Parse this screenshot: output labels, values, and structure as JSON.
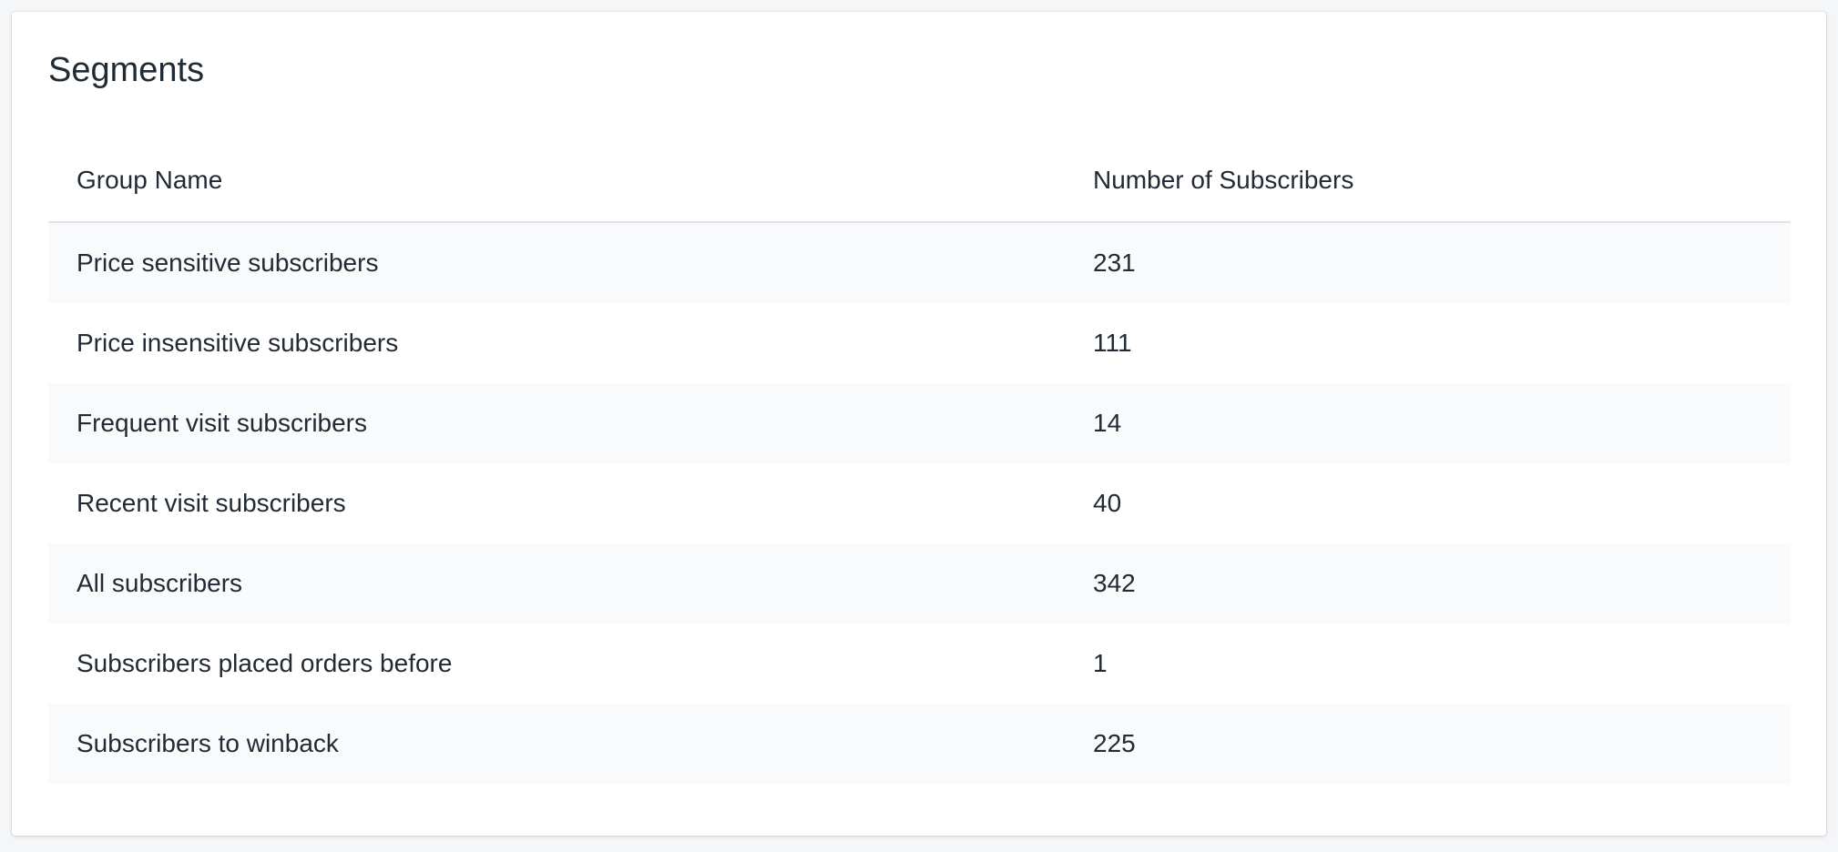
{
  "card": {
    "title": "Segments"
  },
  "table": {
    "columns": {
      "group_name": "Group Name",
      "subscribers": "Number of Subscribers"
    },
    "rows": [
      {
        "name": "Price sensitive subscribers",
        "count": "231"
      },
      {
        "name": "Price insensitive subscribers",
        "count": "111"
      },
      {
        "name": "Frequent visit subscribers",
        "count": "14"
      },
      {
        "name": "Recent visit subscribers",
        "count": "40"
      },
      {
        "name": "All subscribers",
        "count": "342"
      },
      {
        "name": "Subscribers placed orders before",
        "count": "1"
      },
      {
        "name": "Subscribers to winback",
        "count": "225"
      }
    ]
  }
}
